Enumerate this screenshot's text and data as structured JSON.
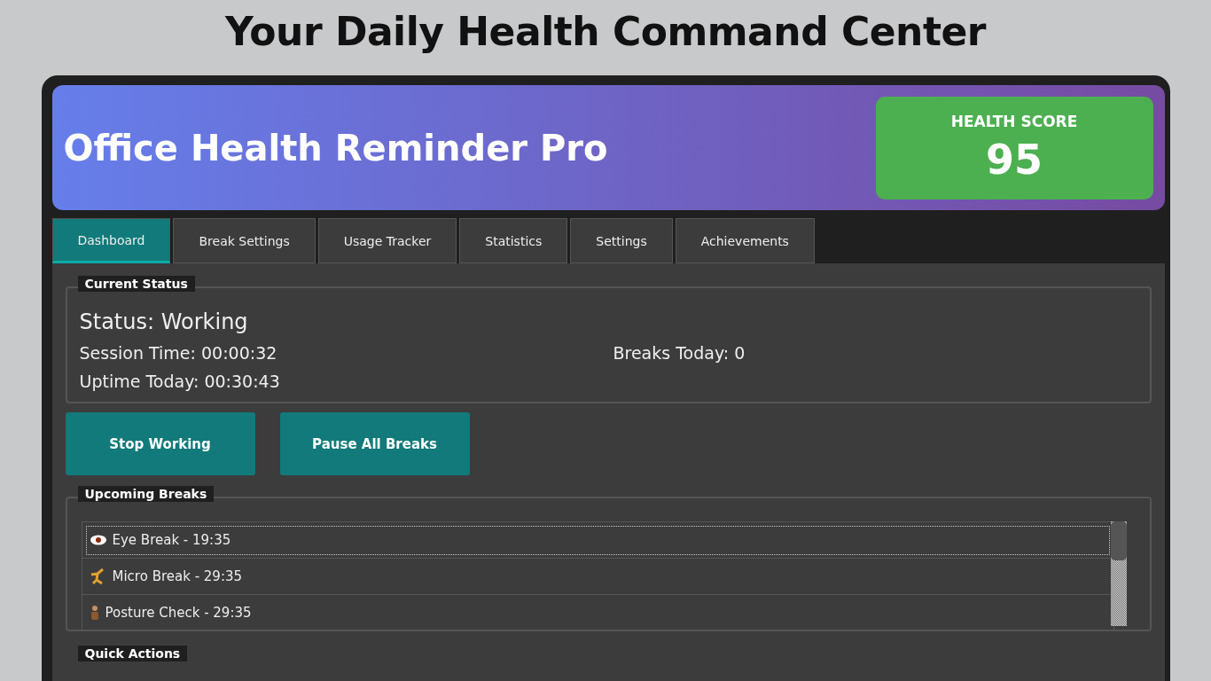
{
  "page_title": "Your Daily Health Command Center",
  "header": {
    "title": "Office Health Reminder Pro",
    "score_label": "HEALTH SCORE",
    "score": "95"
  },
  "tabs": [
    {
      "label": "Dashboard",
      "selected": true
    },
    {
      "label": "Break Settings",
      "selected": false
    },
    {
      "label": "Usage Tracker",
      "selected": false
    },
    {
      "label": "Statistics",
      "selected": false
    },
    {
      "label": "Settings",
      "selected": false
    },
    {
      "label": "Achievements",
      "selected": false
    }
  ],
  "current_status": {
    "title": "Current Status",
    "status": "Status: Working",
    "session_time": "Session Time: 00:00:32",
    "breaks_today": "Breaks Today: 0",
    "uptime": "Uptime Today: 00:30:43"
  },
  "buttons": [
    "Stop Working",
    "Pause All Breaks"
  ],
  "upcoming_breaks": {
    "title": "Upcoming Breaks",
    "items": [
      {
        "kind": "eye",
        "label": "Eye Break - 19:35",
        "selected": true
      },
      {
        "kind": "micro",
        "label": "Micro Break - 29:35",
        "selected": false
      },
      {
        "kind": "posture",
        "label": "Posture Check - 29:35",
        "selected": false
      }
    ]
  },
  "quick_actions": {
    "title": "Quick Actions"
  }
}
